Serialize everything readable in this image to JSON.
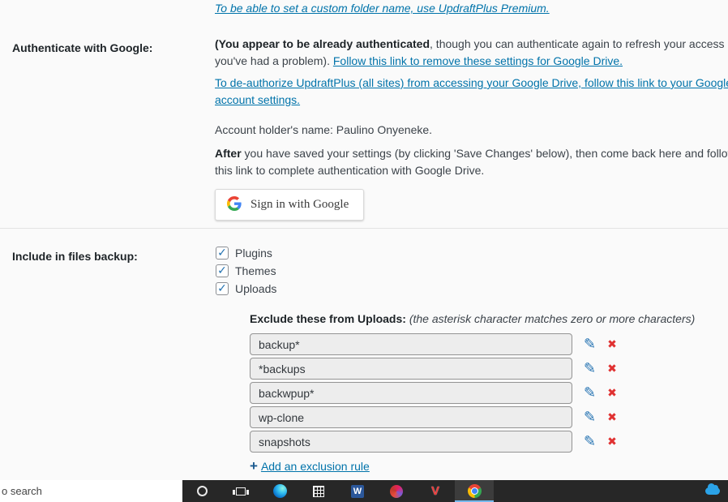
{
  "premium_note": {
    "text": "To be able to set a custom folder name, use UpdraftPlus Premium."
  },
  "google_auth": {
    "label": "Authenticate with Google:",
    "authenticated_bold": "(You appear to be already authenticated",
    "authenticated_rest": ", though you can authenticate again to refresh your access if you've had a problem). ",
    "remove_link": "Follow this link to remove these settings for Google Drive.",
    "deauthorize_link": "To de-authorize UpdraftPlus (all sites) from accessing your Google Drive, follow this link to your Google account settings.",
    "account_holder": "Account holder's name: Paulino Onyeneke.",
    "after_bold": "After",
    "after_rest": " you have saved your settings (by clicking 'Save Changes' below), then come back here and follow this link to complete authentication with Google Drive.",
    "signin_label": "Sign in with Google"
  },
  "files_backup": {
    "label": "Include in files backup:",
    "options": [
      {
        "label": "Plugins",
        "checked": true
      },
      {
        "label": "Themes",
        "checked": true
      },
      {
        "label": "Uploads",
        "checked": true
      }
    ],
    "exclude_title": "Exclude these from Uploads:",
    "exclude_hint": " (the asterisk character matches zero or more characters)",
    "rules": [
      {
        "value": "backup*"
      },
      {
        "value": "*backups"
      },
      {
        "value": "backwpup*"
      },
      {
        "value": "wp-clone"
      },
      {
        "value": "snapshots"
      }
    ],
    "add_rule_label": "Add an exclusion rule"
  },
  "icons": {
    "check": "✓",
    "edit": "✎",
    "delete": "✖",
    "plus": "+",
    "word": "W",
    "vivaldi": "V"
  },
  "taskbar": {
    "search_text": "o search"
  }
}
